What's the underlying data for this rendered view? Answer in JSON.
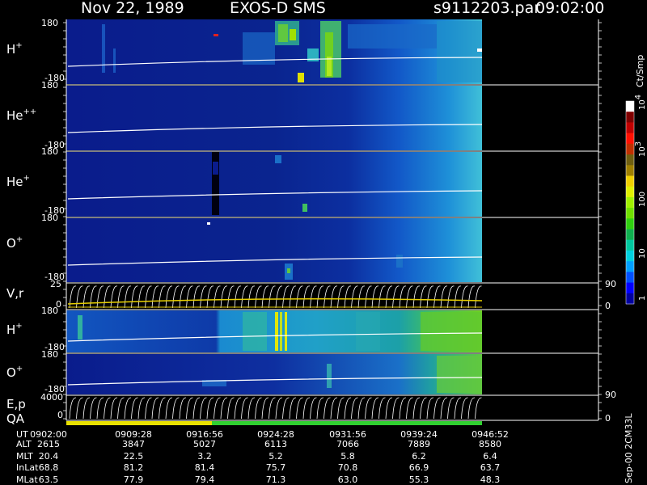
{
  "header": {
    "date": "Nov 22, 1989",
    "instrument": "EXOS-D SMS",
    "file": "s9112203.par",
    "time": "09:02:00"
  },
  "panels": [
    {
      "label_base": "H",
      "label_sup": "+",
      "tick_top": "180",
      "tick_bottom": "-180"
    },
    {
      "label_base": "He",
      "label_sup": "++",
      "tick_top": "180",
      "tick_bottom": "-180"
    },
    {
      "label_base": "He",
      "label_sup": "+",
      "tick_top": "180",
      "tick_bottom": "-180"
    },
    {
      "label_base": "O",
      "label_sup": "+",
      "tick_top": "180",
      "tick_bottom": "-180"
    },
    {
      "label_base": "V,r",
      "label_sup": "",
      "tick_top": "25",
      "tick_bottom": "0",
      "right_top": "90",
      "right_bottom": "0"
    },
    {
      "label_base": "H",
      "label_sup": "+",
      "tick_top": "180",
      "tick_bottom": "-180"
    },
    {
      "label_base": "O",
      "label_sup": "+",
      "tick_top": "180",
      "tick_bottom": "-180"
    },
    {
      "label_base": "E,p",
      "label_sup": "",
      "tick_top": "4000",
      "tick_bottom": "0",
      "right_top": "90",
      "right_bottom": "0"
    }
  ],
  "qa_label": "QA",
  "colorbar": {
    "label": "Ct/Smp",
    "ticks": [
      "1",
      "10",
      "100",
      "10",
      "10"
    ],
    "tick_sups": [
      "",
      "",
      "",
      "3",
      "4"
    ],
    "colors": [
      "#0000a0",
      "#0000ff",
      "#0050ff",
      "#00a0ff",
      "#00d0e0",
      "#00c8a0",
      "#10b050",
      "#30d010",
      "#70e000",
      "#a0f000",
      "#e0f000",
      "#f0d000",
      "#a08000",
      "#706010",
      "#c03000",
      "#ff1000",
      "#c00000",
      "#800000",
      "#ffffff"
    ]
  },
  "footer_note": "Sep-00  2CM33L",
  "table": {
    "rows": [
      {
        "label": "UT",
        "values": [
          "0902:00",
          "0909:28",
          "0916:56",
          "0924:28",
          "0931:56",
          "0939:24",
          "0946:52"
        ]
      },
      {
        "label": "ALT",
        "values": [
          "2615",
          "3847",
          "5027",
          "6113",
          "7066",
          "7889",
          "8580"
        ]
      },
      {
        "label": "MLT",
        "values": [
          "20.4",
          "22.5",
          "3.2",
          "5.2",
          "5.8",
          "6.2",
          "6.4"
        ]
      },
      {
        "label": "InLat",
        "values": [
          "68.8",
          "81.2",
          "81.4",
          "75.7",
          "70.8",
          "66.9",
          "63.7"
        ]
      },
      {
        "label": "MLat",
        "values": [
          "63.5",
          "77.9",
          "79.4",
          "71.3",
          "63.0",
          "55.3",
          "48.3"
        ]
      }
    ]
  },
  "chart_data": {
    "type": "heatmap",
    "title": "Nov 22, 1989   EXOS-D SMS",
    "x": [
      "0902:00",
      "0909:28",
      "0916:56",
      "0924:28",
      "0931:56",
      "0939:24",
      "0946:52"
    ],
    "panels": [
      {
        "name": "H+",
        "ylim": [
          -180,
          180
        ]
      },
      {
        "name": "He++",
        "ylim": [
          -180,
          180
        ]
      },
      {
        "name": "He+",
        "ylim": [
          -180,
          180
        ]
      },
      {
        "name": "O+",
        "ylim": [
          -180,
          180
        ]
      },
      {
        "name": "V,r",
        "ylim": [
          0,
          25
        ],
        "right_ylim": [
          0,
          90
        ]
      },
      {
        "name": "H+",
        "ylim": [
          -180,
          180
        ]
      },
      {
        "name": "O+",
        "ylim": [
          -180,
          180
        ]
      },
      {
        "name": "E,p",
        "ylim": [
          0,
          4000
        ],
        "right_ylim": [
          0,
          90
        ]
      }
    ],
    "colorbar": {
      "label": "Ct/Smp",
      "scale": "log",
      "range": [
        1,
        10000
      ]
    },
    "qa": [
      {
        "from": "0902:00",
        "to": "0916:56",
        "color": "#e8e000"
      },
      {
        "from": "0916:56",
        "to": "0946:52",
        "color": "#30d030"
      }
    ]
  }
}
